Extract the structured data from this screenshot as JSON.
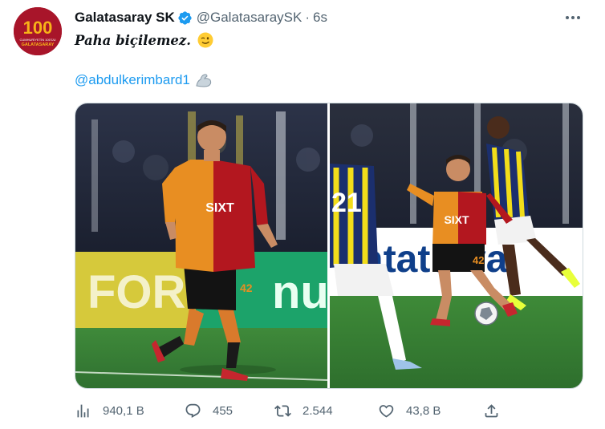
{
  "avatar": {
    "badge_number": "100",
    "badge_line1": "CUMHURİYETİN 100'ÜU",
    "badge_line2": "GALATASARAY",
    "brand_color": "#a8152a",
    "accent_color": "#f7b318"
  },
  "header": {
    "name": "Galatasaray SK",
    "handle": "@GalatasaraySK",
    "separator": "·",
    "time": "6s",
    "verified_color": "#1d9bf0"
  },
  "tweet": {
    "text": "Paha biçilemez.",
    "text_emoji": "winking-face",
    "mention": "@abdulkerimbard1",
    "mention_emoji": "flexed-biceps",
    "link_color": "#1d9bf0"
  },
  "media": {
    "photos": [
      {
        "name": "photo-player-dribbling",
        "banner_text": "FOR",
        "banner_text_right": "nu",
        "shirt_sponsor": "SIXT",
        "shirt_number": "42"
      },
      {
        "name": "photo-player-on-ball",
        "banner_text": "atatu va",
        "shirt_sponsor": "SIXT",
        "shirt_number": "42",
        "opponent_number": "21"
      }
    ]
  },
  "actions": {
    "views": "940,1 B",
    "replies": "455",
    "retweets": "2.544",
    "likes": "43,8 B",
    "icons": [
      "views-icon",
      "reply-icon",
      "retweet-icon",
      "like-icon",
      "share-icon"
    ]
  }
}
